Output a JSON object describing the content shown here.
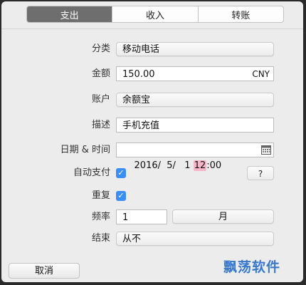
{
  "tabs": [
    {
      "label": "支出",
      "active": true
    },
    {
      "label": "收入",
      "active": false
    },
    {
      "label": "转账",
      "active": false
    }
  ],
  "form": {
    "category": {
      "label": "分类",
      "value": "移动电话"
    },
    "amount": {
      "label": "金额",
      "value": "150.00",
      "currency": "CNY"
    },
    "account": {
      "label": "账户",
      "value": "余额宝"
    },
    "description": {
      "label": "描述",
      "value": "手机充值"
    },
    "datetime": {
      "label": "日期 & 时间",
      "date": "2016/  5/   1 ",
      "hour": "12",
      "minute": ":00"
    },
    "auto_pay": {
      "label": "自动支付",
      "checked": true,
      "help_label": "?"
    },
    "repeat": {
      "label": "重复",
      "checked": true
    },
    "frequency": {
      "label": "频率",
      "value": "1",
      "unit": "月"
    },
    "end": {
      "label": "结束",
      "value": "从不"
    }
  },
  "buttons": {
    "cancel": "取消"
  },
  "watermark": "飘荡软件",
  "colors": {
    "accent": "#3b8df7",
    "active_tab": "#6e6e6e",
    "selection": "#f6b5c8",
    "watermark": "#3b78c8"
  },
  "icons": {
    "calendar": "calendar-icon",
    "checkmark": "checkmark-icon"
  }
}
